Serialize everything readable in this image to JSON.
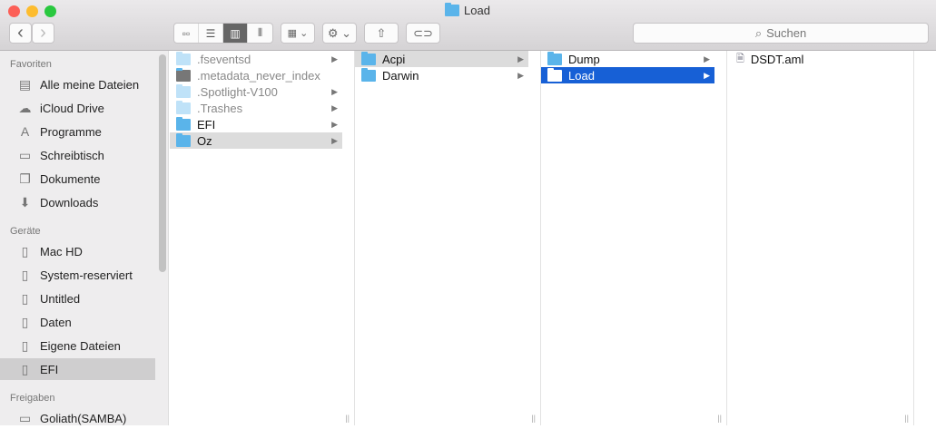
{
  "window": {
    "title": "Load"
  },
  "toolbar": {
    "back": "‹",
    "forward": "›",
    "search_placeholder": "Suchen"
  },
  "sidebar": {
    "sections": [
      {
        "label": "Favoriten",
        "items": [
          {
            "label": "Alle meine Dateien",
            "icon": "all-files-icon"
          },
          {
            "label": "iCloud Drive",
            "icon": "cloud-icon"
          },
          {
            "label": "Programme",
            "icon": "applications-icon"
          },
          {
            "label": "Schreibtisch",
            "icon": "desktop-icon"
          },
          {
            "label": "Dokumente",
            "icon": "documents-icon"
          },
          {
            "label": "Downloads",
            "icon": "downloads-icon"
          }
        ]
      },
      {
        "label": "Geräte",
        "items": [
          {
            "label": "Mac HD"
          },
          {
            "label": "System-reserviert"
          },
          {
            "label": "Untitled"
          },
          {
            "label": "Daten"
          },
          {
            "label": "Eigene Dateien"
          },
          {
            "label": "EFI",
            "selected": true
          }
        ]
      },
      {
        "label": "Freigaben",
        "items": [
          {
            "label": "Goliath(SAMBA)"
          }
        ]
      }
    ]
  },
  "columns": [
    [
      {
        "name": ".fseventsd",
        "hidden": true,
        "folder": true
      },
      {
        "name": ".metadata_never_index",
        "hidden": true,
        "folder": false
      },
      {
        "name": ".Spotlight-V100",
        "hidden": true,
        "folder": true
      },
      {
        "name": ".Trashes",
        "hidden": true,
        "folder": true
      },
      {
        "name": "EFI",
        "folder": true
      },
      {
        "name": "Oz",
        "folder": true,
        "selected": "inactive"
      }
    ],
    [
      {
        "name": "Acpi",
        "folder": true,
        "selected": "inactive"
      },
      {
        "name": "Darwin",
        "folder": true
      }
    ],
    [
      {
        "name": "Dump",
        "folder": true
      },
      {
        "name": "Load",
        "folder": true,
        "selected": "active"
      }
    ],
    [
      {
        "name": "DSDT.aml",
        "folder": false
      }
    ]
  ],
  "colors": {
    "selection": "#1760d6",
    "inactive_selection": "#dcdcdc"
  }
}
